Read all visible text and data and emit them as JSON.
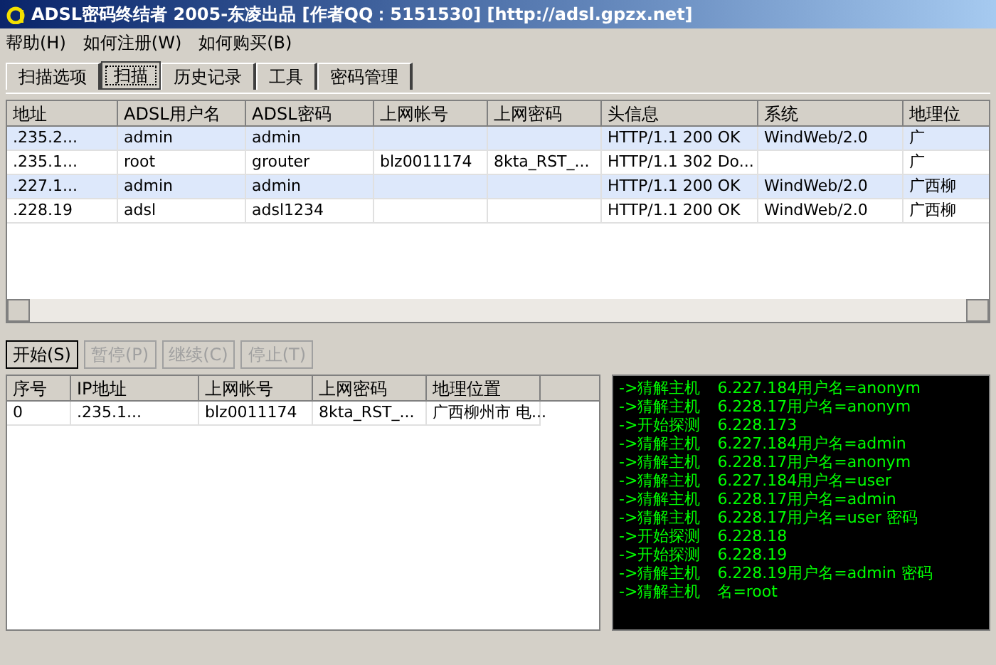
{
  "window": {
    "title": "ADSL密码终结者 2005-东凌出品 [作者QQ：5151530] [http://adsl.gpzx.net]"
  },
  "menu": [
    {
      "label": "帮助(H)"
    },
    {
      "label": "如何注册(W)"
    },
    {
      "label": "如何购买(B)"
    }
  ],
  "tabs": [
    {
      "label": "扫描选项",
      "selected": false
    },
    {
      "label": "扫描",
      "selected": true
    },
    {
      "label": "历史记录",
      "selected": false
    },
    {
      "label": "工具",
      "selected": false
    },
    {
      "label": "密码管理",
      "selected": false
    }
  ],
  "results": {
    "columns": [
      "地址",
      "ADSL用户名",
      "ADSL密码",
      "上网帐号",
      "上网密码",
      "头信息",
      "系统",
      "地理位"
    ],
    "rows": [
      {
        "highlighted": true,
        "cells": [
          ".235.2...",
          "admin",
          "admin",
          "",
          "",
          "HTTP/1.1 200 OK",
          "WindWeb/2.0",
          "广"
        ]
      },
      {
        "highlighted": false,
        "cells": [
          ".235.1...",
          "root",
          "grouter",
          "blz0011174",
          "8kta_RST_...",
          "HTTP/1.1 302 Do...",
          "",
          "广"
        ]
      },
      {
        "highlighted": true,
        "cells": [
          ".227.1...",
          "admin",
          "admin",
          "",
          "",
          "HTTP/1.1 200 OK",
          "WindWeb/2.0",
          "广西柳"
        ]
      },
      {
        "highlighted": false,
        "cells": [
          ".228.19",
          "adsl",
          "adsl1234",
          "",
          "",
          "HTTP/1.1 200 OK",
          "WindWeb/2.0",
          "广西柳"
        ]
      }
    ]
  },
  "buttons": [
    {
      "label": "开始(S)",
      "disabled": false
    },
    {
      "label": "暂停(P)",
      "disabled": true
    },
    {
      "label": "继续(C)",
      "disabled": true
    },
    {
      "label": "停止(T)",
      "disabled": true
    }
  ],
  "found": {
    "columns": [
      "序号",
      "IP地址",
      "上网帐号",
      "上网密码",
      "地理位置"
    ],
    "rows": [
      {
        "cells": [
          "0",
          ".235.1...",
          "blz0011174",
          "8kta_RST_...",
          "广西柳州市 电..."
        ]
      }
    ]
  },
  "log": [
    "->猜解主机",
    "->猜解主机",
    "->开始探测",
    "->猜解主机",
    "->猜解主机",
    "->猜解主机",
    "->猜解主机",
    "->猜解主机",
    "->开始探测",
    "->开始探测",
    "->猜解主机",
    "->猜解主机"
  ],
  "log_tails": [
    "6.227.184用户名=anonym",
    "6.228.17用户名=anonym",
    "6.228.173",
    "6.227.184用户名=admin",
    "6.228.17用户名=anonym",
    "6.227.184用户名=user",
    "6.228.17用户名=admin",
    "6.228.17用户名=user 密码",
    "6.228.18",
    "6.228.19",
    "6.228.19用户名=admin 密码",
    "名=root"
  ]
}
